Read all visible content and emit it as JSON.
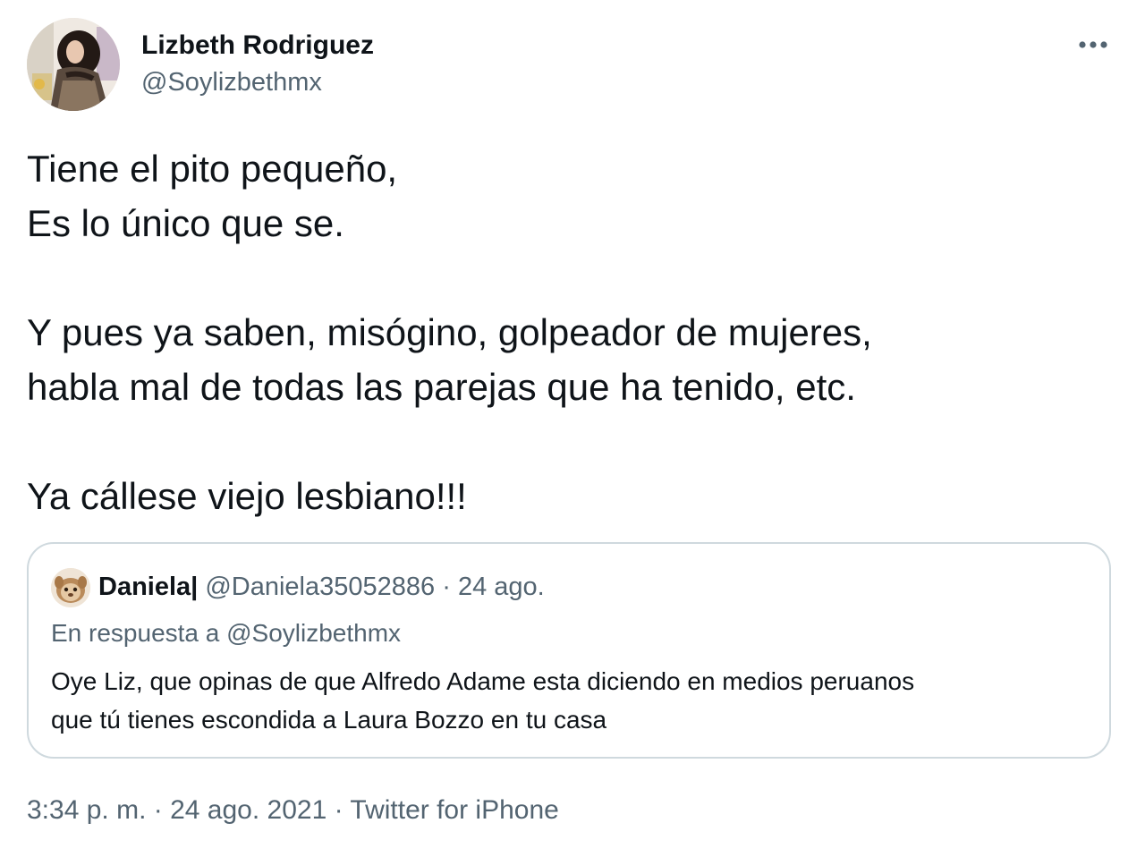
{
  "author": {
    "name": "Lizbeth Rodriguez",
    "handle": "@Soylizbethmx"
  },
  "more_icon": "more-horizontal-icon",
  "tweet": {
    "lines": [
      "Tiene el pito pequeño,",
      "Es lo único que se.",
      "",
      "Y pues ya saben, misógino, golpeador de mujeres,",
      "habla mal de todas las parejas que ha tenido, etc.",
      "",
      "Ya cállese viejo lesbiano!!!"
    ]
  },
  "quoted": {
    "name": "Daniela|",
    "handle": "@Daniela35052886",
    "separator": "·",
    "date": "24 ago.",
    "reply_to": "En respuesta a @Soylizbethmx",
    "lines": [
      "Oye Liz, que opinas de que Alfredo Adame esta diciendo en medios peruanos",
      "que tú tienes escondida a Laura Bozzo en tu casa"
    ]
  },
  "meta": {
    "time": "3:34 p. m.",
    "separator": "·",
    "date": "24 ago. 2021",
    "source": "Twitter for iPhone"
  },
  "colors": {
    "text_primary": "#0f1419",
    "text_secondary": "#536471",
    "border": "#cfd9de"
  }
}
